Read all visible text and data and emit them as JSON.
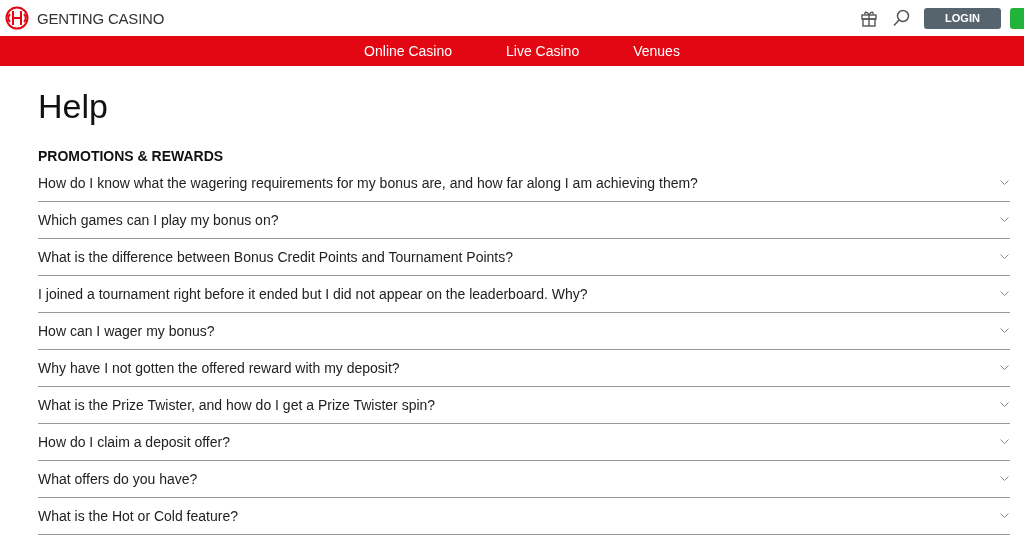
{
  "header": {
    "brand": "GENTING CASINO",
    "login": "LOGIN"
  },
  "nav": [
    "Online Casino",
    "Live Casino",
    "Venues"
  ],
  "page": {
    "title": "Help",
    "section": "PROMOTIONS & REWARDS"
  },
  "faq": [
    {
      "question": "How do I know what the wagering requirements for my bonus are, and how far along I am achieving them?"
    },
    {
      "question": "Which games can I play my bonus on?"
    },
    {
      "question": "What is the difference between Bonus Credit Points and Tournament Points?"
    },
    {
      "question": "I joined a tournament right before it ended but I did not appear on the leaderboard. Why?"
    },
    {
      "question": "How can I wager my bonus?"
    },
    {
      "question": "Why have I not gotten the offered reward with my deposit?"
    },
    {
      "question": "What is the Prize Twister, and how do I get a Prize Twister spin?"
    },
    {
      "question": "How do I claim a deposit offer?"
    },
    {
      "question": "What offers do you have?"
    },
    {
      "question": "What is the Hot or Cold feature?"
    }
  ]
}
